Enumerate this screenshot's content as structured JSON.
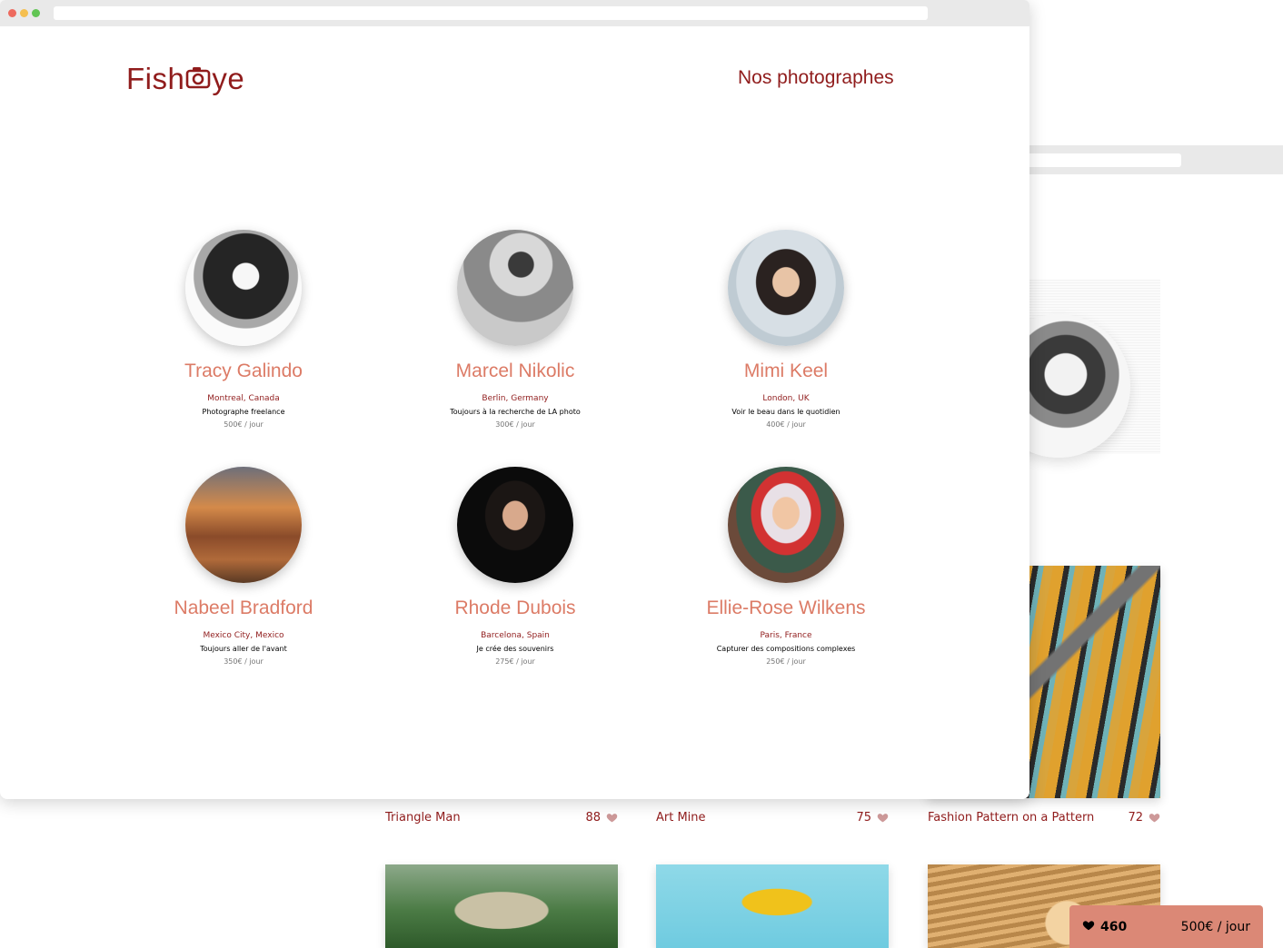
{
  "front": {
    "logo_text_left": "Fish",
    "logo_text_right": "ye",
    "nav_title": "Nos photographes",
    "photographers": [
      {
        "name": "Tracy Galindo",
        "location": "Montreal, Canada",
        "tagline": "Photographe freelance",
        "price": "500€ / jour"
      },
      {
        "name": "Marcel Nikolic",
        "location": "Berlin, Germany",
        "tagline": "Toujours à la recherche de LA photo",
        "price": "300€ / jour"
      },
      {
        "name": "Mimi Keel",
        "location": "London, UK",
        "tagline": "Voir le beau dans le quotidien",
        "price": "400€ / jour"
      },
      {
        "name": "Nabeel Bradford",
        "location": "Mexico City, Mexico",
        "tagline": "Toujours aller de l'avant",
        "price": "350€ / jour"
      },
      {
        "name": "Rhode Dubois",
        "location": "Barcelona, Spain",
        "tagline": "Je crée des souvenirs",
        "price": "275€ / jour"
      },
      {
        "name": "Ellie-Rose Wilkens",
        "location": "Paris, France",
        "tagline": "Capturer des compositions complexes",
        "price": "250€ / jour"
      }
    ]
  },
  "back": {
    "media": [
      {
        "title": "Triangle Man",
        "likes": "88"
      },
      {
        "title": "Art Mine",
        "likes": "75"
      },
      {
        "title": "Fashion Pattern on a Pattern",
        "likes": "72"
      }
    ],
    "likes_bar": {
      "total": "460",
      "price": "500€ / jour"
    }
  },
  "colors": {
    "brand": "#901c1c",
    "name_accent": "#d3573c",
    "likes_bar_bg": "#db8876",
    "heart": "#901c1c"
  },
  "icons": [
    "camera-icon",
    "heart-icon"
  ]
}
